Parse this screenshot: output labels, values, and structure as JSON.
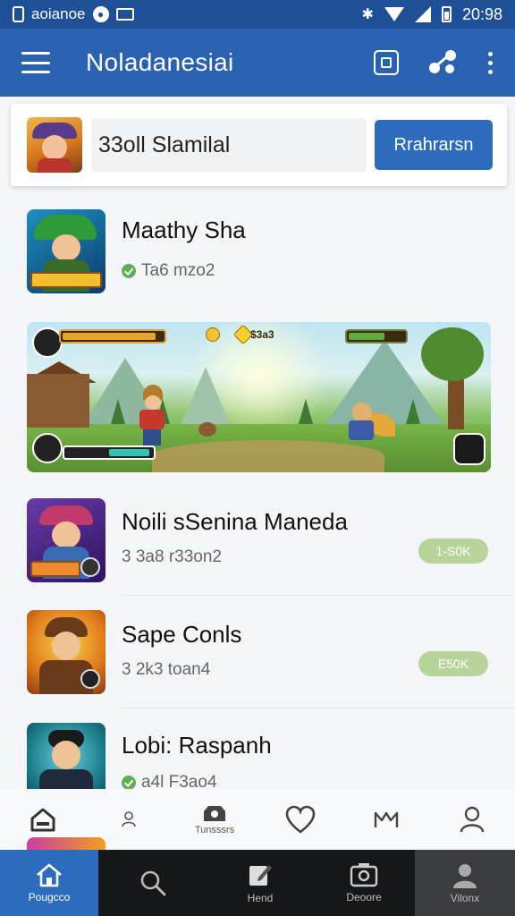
{
  "status_bar": {
    "app_label": "aoianoe",
    "time": "20:98"
  },
  "app_bar": {
    "title": "Noladanesiai"
  },
  "profile": {
    "name": "33oll Slamilal",
    "action_label": "Rrahrarsn"
  },
  "games": [
    {
      "title": "Maathy Sha",
      "subtitle": "Ta6 mzo2",
      "verified": true
    },
    {
      "title": "Noili sSenina Maneda",
      "subtitle": "3 3a8 r33on2",
      "pill": "1-S0K"
    },
    {
      "title": "Sape Conls",
      "subtitle": "3 2k3 toan4",
      "pill": "E50K"
    },
    {
      "title": "Lobi: Raspanh",
      "subtitle": "a4l F3ao4",
      "verified": true
    }
  ],
  "banner": {
    "hud_score": "$3a3"
  },
  "nav_light": [
    {
      "icon": "home-icon",
      "label": ""
    },
    {
      "icon": "person-small-icon",
      "label": ""
    },
    {
      "icon": "camera-icon",
      "label": "Tunsssrs"
    },
    {
      "icon": "heart-icon",
      "label": ""
    },
    {
      "icon": "crown-icon",
      "label": ""
    },
    {
      "icon": "profile-icon",
      "label": ""
    }
  ],
  "nav_dark": [
    {
      "icon": "home-icon",
      "label": "Pougcco"
    },
    {
      "icon": "search-icon",
      "label": ""
    },
    {
      "icon": "edit-icon",
      "label": "Hend"
    },
    {
      "icon": "photo-icon",
      "label": "Deoore"
    },
    {
      "icon": "account-icon",
      "label": "Vilonx"
    }
  ],
  "colors": {
    "app_bar": "#2a62b0",
    "status_bar": "#1f4f96",
    "accent_button": "#2d6cbc",
    "pill_green": "#b7d49a",
    "nav_dark": "#151719"
  }
}
